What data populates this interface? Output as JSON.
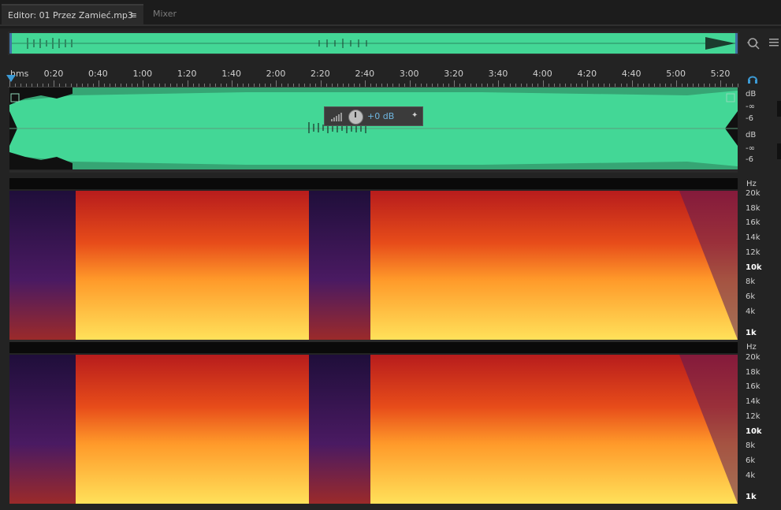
{
  "tabs": {
    "editor_label": "Editor: 01 Przez Zamieć.mp3",
    "menu_glyph": "≡",
    "mixer_label": "Mixer"
  },
  "ruler": {
    "unit": "hms",
    "marks": [
      "0:20",
      "0:40",
      "1:00",
      "1:20",
      "1:40",
      "2:00",
      "2:20",
      "2:40",
      "3:00",
      "3:20",
      "3:40",
      "4:00",
      "4:20",
      "4:40",
      "5:00",
      "5:20"
    ]
  },
  "hud": {
    "gain": "+0 dB"
  },
  "db_scale": {
    "unit": "dB",
    "inf": "-∞",
    "minus6": "-6"
  },
  "hz_scale": {
    "unit": "Hz",
    "labels": [
      "20k",
      "18k",
      "16k",
      "14k",
      "12k",
      "10k",
      "8k",
      "6k",
      "4k",
      "1k"
    ]
  },
  "icons": [
    "zoom-icon",
    "menu-icon",
    "headphones-icon",
    "pin-icon",
    "volume-bars-icon"
  ],
  "colors": {
    "waveform": "#43d796",
    "playhead": "#3c9bd6",
    "spectral_hot": "#ffd23a",
    "spectral_mid": "#d61b1b",
    "spectral_cold": "#2a1250"
  }
}
